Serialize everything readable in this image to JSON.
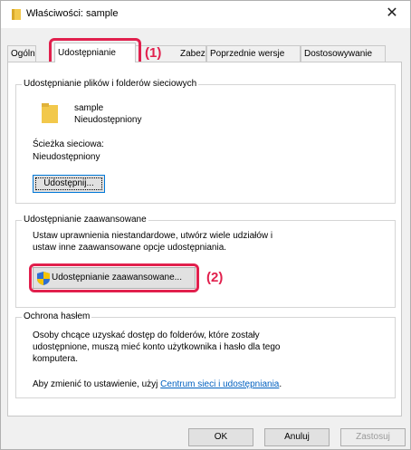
{
  "window": {
    "title": "Właściwości: sample",
    "close_glyph": "✕"
  },
  "tabs": [
    {
      "label": "Ogólne"
    },
    {
      "label": "Udostępnianie"
    },
    {
      "label": "Zabezpieczenia"
    },
    {
      "label": "Poprzednie wersje"
    },
    {
      "label": "Dostosowywanie"
    }
  ],
  "sharing": {
    "group_title": "Udostępnianie plików i folderów sieciowych",
    "item_name": "sample",
    "item_status": "Nieudostępniony",
    "path_label": "Ścieżka sieciowa:",
    "path_value": "Nieudostępniony",
    "share_button": "Udostępnij..."
  },
  "advanced": {
    "group_title": "Udostępnianie zaawansowane",
    "desc_line1": "Ustaw uprawnienia niestandardowe, utwórz wiele udziałów i",
    "desc_line2": "ustaw inne zaawansowane opcje udostępniania.",
    "button": "Udostępnianie zaawansowane..."
  },
  "password": {
    "group_title": "Ochrona hasłem",
    "line1": "Osoby chcące uzyskać dostęp do folderów, które zostały",
    "line2": "udostępnione, muszą mieć konto użytkownika i hasło dla tego",
    "line3": "komputera.",
    "change_prefix": "Aby zmienić to ustawienie, użyj ",
    "link": "Centrum sieci i udostępniania",
    "change_suffix": "."
  },
  "footer": {
    "ok": "OK",
    "cancel": "Anuluj",
    "apply": "Zastosuj"
  },
  "callouts": {
    "one": "(1)",
    "two": "(2)"
  },
  "colors": {
    "highlight": "#e1204d",
    "folder": "#f2c84b",
    "link": "#0060c0"
  },
  "icons": {
    "title": "folder-icon",
    "item": "folder-icon",
    "advanced_button": "shield-icon"
  }
}
